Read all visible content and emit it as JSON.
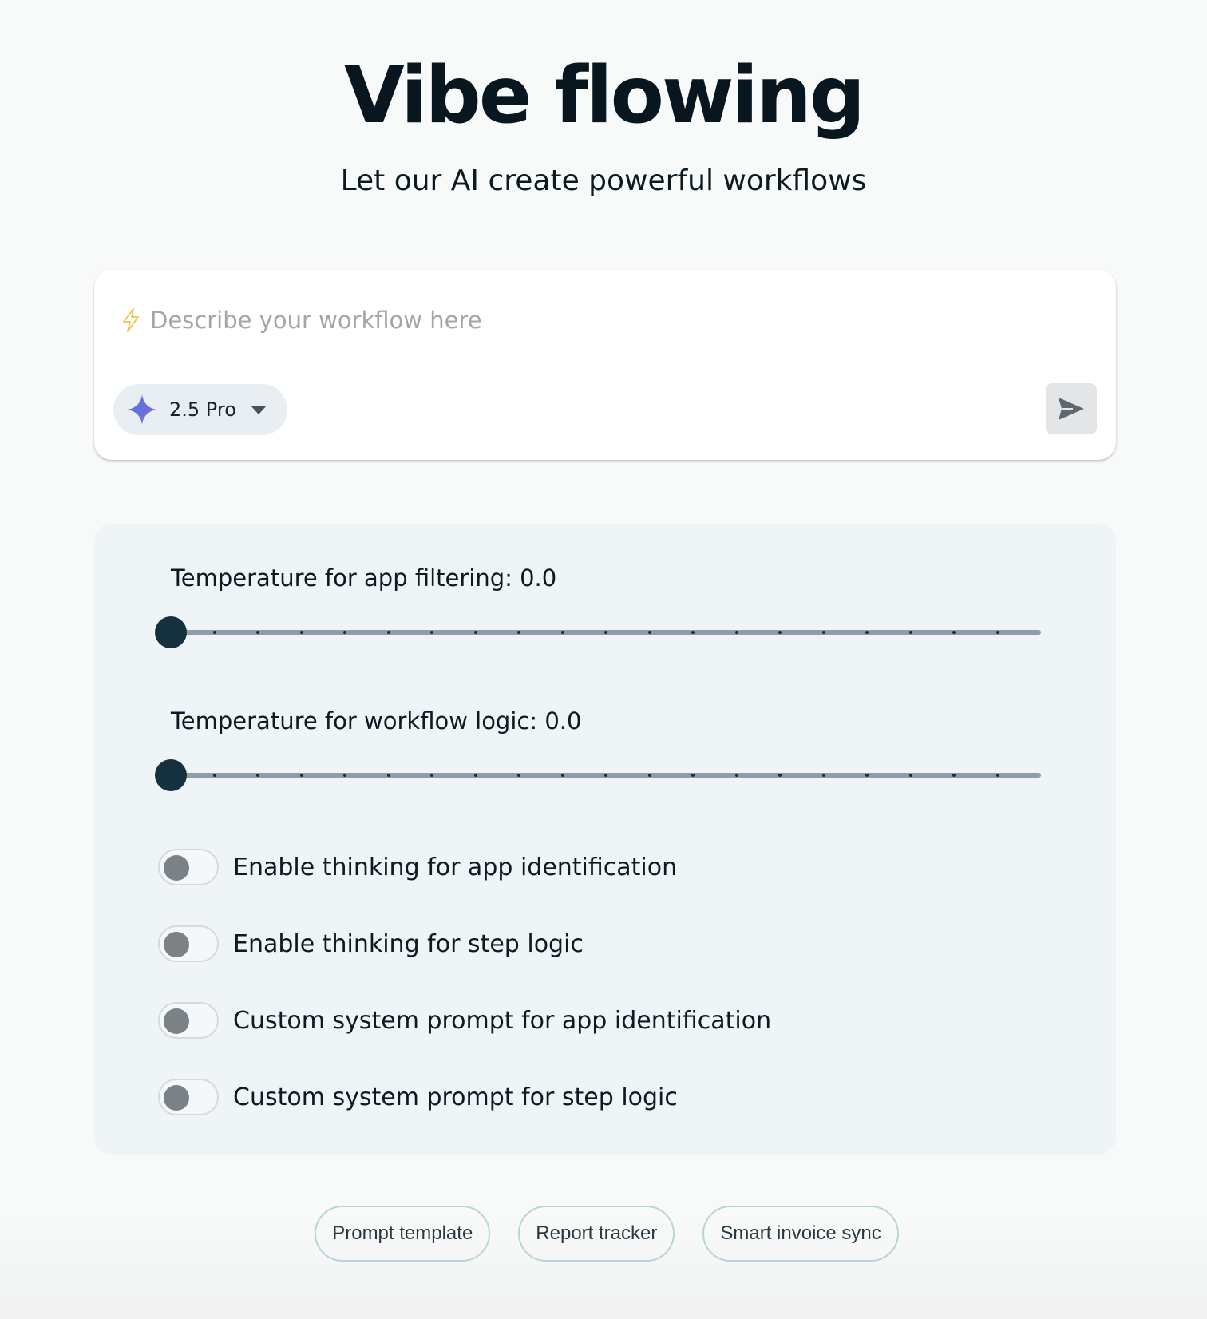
{
  "header": {
    "title": "Vibe flowing",
    "subtitle": "Let our AI create powerful workflows"
  },
  "prompt": {
    "placeholder": "Describe your workflow here",
    "value": "",
    "bolt_icon": "lightning-bolt-icon",
    "model": {
      "label": "2.5 Pro",
      "icon": "sparkle-icon",
      "dropdown_icon": "chevron-down-icon"
    },
    "send_icon": "send-arrow-icon"
  },
  "settings": {
    "sliders": [
      {
        "label": "Temperature for app filtering: 0.0",
        "value": 0.0,
        "min": 0.0,
        "max": 2.0,
        "step": 0.1
      },
      {
        "label": "Temperature for workflow logic: 0.0",
        "value": 0.0,
        "min": 0.0,
        "max": 2.0,
        "step": 0.1
      }
    ],
    "toggles": [
      {
        "label": "Enable thinking for app identification",
        "checked": false
      },
      {
        "label": "Enable thinking for step logic",
        "checked": false
      },
      {
        "label": "Custom system prompt for app identification",
        "checked": false
      },
      {
        "label": "Custom system prompt for step logic",
        "checked": false
      }
    ]
  },
  "suggestions": [
    {
      "label": "Prompt template"
    },
    {
      "label": "Report tracker"
    },
    {
      "label": "Smart invoice sync"
    }
  ],
  "colors": {
    "page_background": "#f8fafa",
    "title": "#08161f",
    "slider_thumb": "#14313d",
    "slider_track": "#8e9ea5",
    "panel_background": "#eff4f7",
    "chip_border": "#b5d5db",
    "bolt": "#f2c14e"
  }
}
